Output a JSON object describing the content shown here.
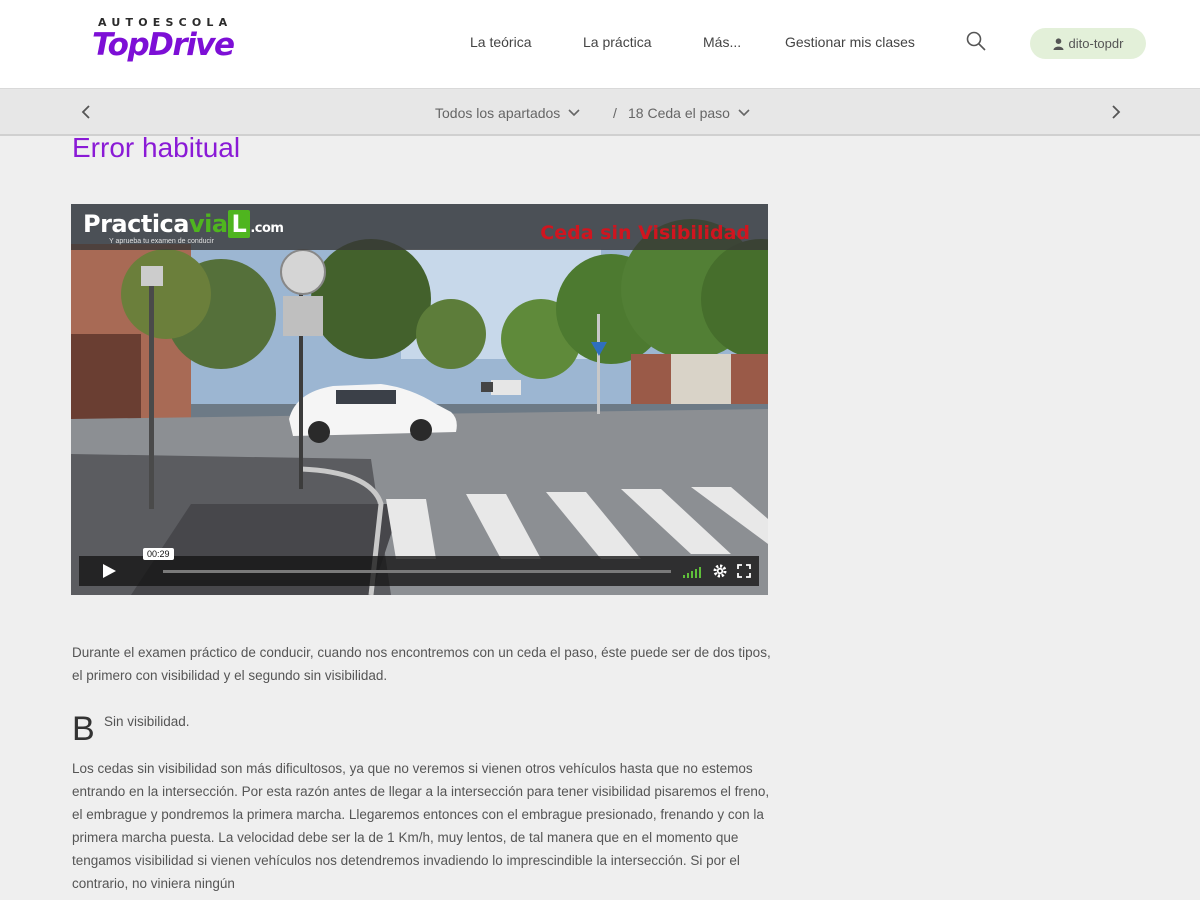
{
  "logo": {
    "top": "AUTOESCOLA",
    "main": "TopDrive"
  },
  "nav": {
    "items": [
      "La teórica",
      "La práctica",
      "Más...",
      "Gestionar mis clases"
    ],
    "user": "dito-topdr"
  },
  "breadcrumb": {
    "section": "Todos los apartados",
    "separator": "/",
    "current": "18 Ceda el paso"
  },
  "page": {
    "title": "Error habitual"
  },
  "video": {
    "brand_practica": "Practica",
    "brand_via": "via",
    "brand_l": "L",
    "brand_com": ".com",
    "brand_sub": "Y aprueba tu examen de conducir",
    "overlay": "Ceda sin Visibilidad",
    "time": "00:29"
  },
  "content": {
    "intro": "Durante el examen práctico de conducir, cuando nos encontremos con un ceda el paso, éste puede ser de dos tipos, el primero con visibilidad y el segundo sin visibilidad.",
    "dropcap": "B",
    "subhead": "Sin visibilidad.",
    "body": "Los cedas sin visibilidad  son más dificultosos, ya que no veremos si vienen otros vehículos hasta que no estemos entrando en la intersección. Por esta razón antes de llegar a la intersección para tener visibilidad pisaremos el freno, el embrague y pondremos la primera marcha. Llegaremos entonces con el embrague presionado, frenando y con la primera marcha puesta. La velocidad debe ser la de 1 Km/h, muy lentos, de tal manera que en el momento que tengamos visibilidad si vienen vehículos nos detendremos invadiendo lo imprescindible la intersección. Si por el contrario, no viniera ningún"
  },
  "colors": {
    "accent": "#8a1ad6",
    "logo": "#7d0fd6",
    "overlay": "#d0151f",
    "pill": "#e3f0d9"
  },
  "icons": [
    "search-icon",
    "user-icon",
    "chevron-left-icon",
    "chevron-right-icon",
    "chevron-down-icon",
    "play-icon",
    "volume-icon",
    "settings-icon",
    "fullscreen-icon"
  ]
}
